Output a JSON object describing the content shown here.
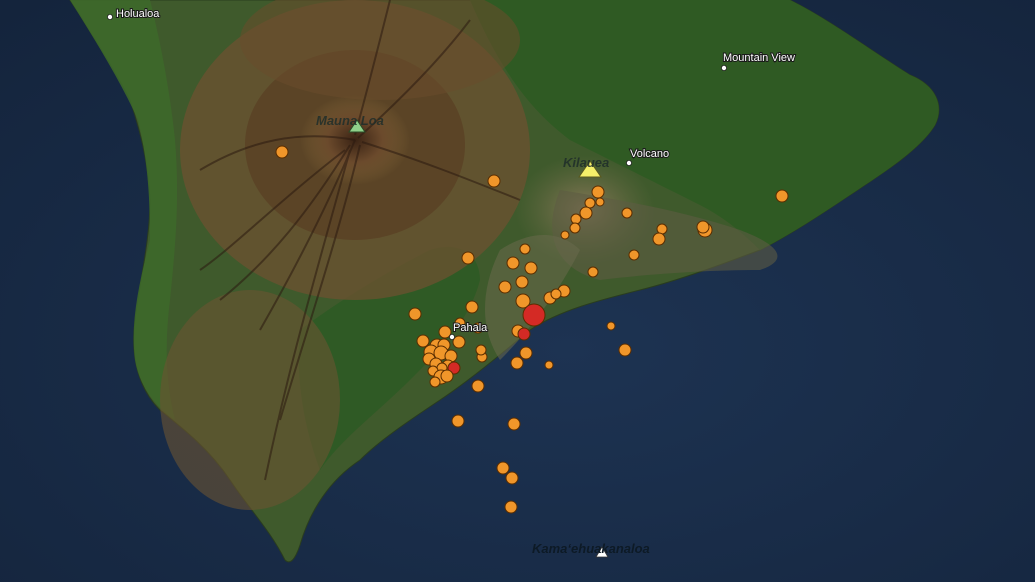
{
  "map": {
    "towns": [
      {
        "name": "Holualoa"
      },
      {
        "name": "Mountain View"
      },
      {
        "name": "Volcano"
      },
      {
        "name": "Pahala"
      }
    ],
    "volcanoes": [
      {
        "name": "Mauna Loa",
        "marker_color": "#8fd18a"
      },
      {
        "name": "Kilauea",
        "marker_color": "#f5f06a"
      },
      {
        "name": "Kama‘ehuakanaloa",
        "marker_color": "#ffffff"
      }
    ],
    "earthquake_colors": {
      "orange": "#f0962a",
      "red": "#d42a25"
    },
    "earthquake_count": 96
  }
}
